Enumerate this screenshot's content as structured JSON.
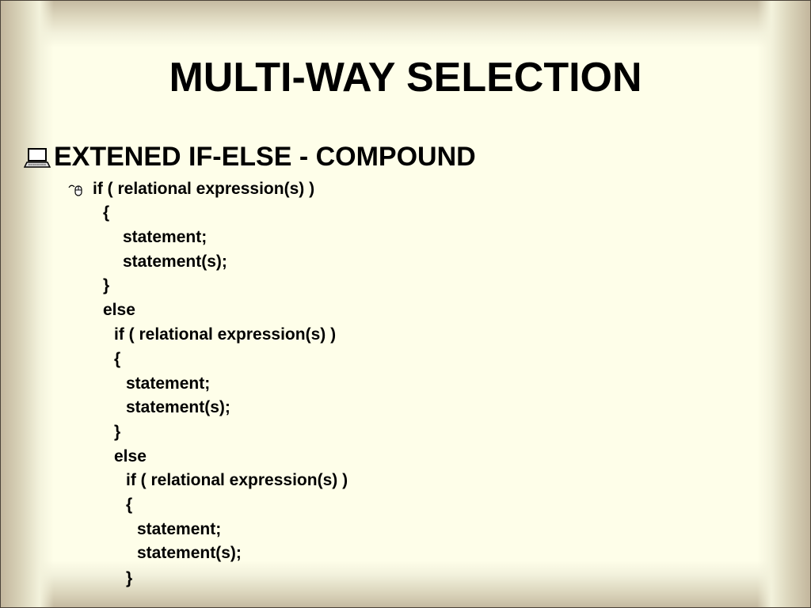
{
  "slide": {
    "title": "MULTI-WAY SELECTION",
    "bullet": {
      "icon": "laptop-computer-icon",
      "text": "EXTENED IF-ELSE - COMPOUND"
    },
    "sub_bullet_icon": "computer-mouse-icon",
    "code_lines": [
      "if ( relational expression(s) )",
      "{",
      "statement;",
      "statement(s);",
      "}",
      "else",
      "if ( relational expression(s) )",
      "{",
      "statement;",
      "statement(s);",
      "}",
      "else",
      "if ( relational expression(s) )",
      "{",
      "statement;",
      "statement(s);",
      "}"
    ]
  }
}
